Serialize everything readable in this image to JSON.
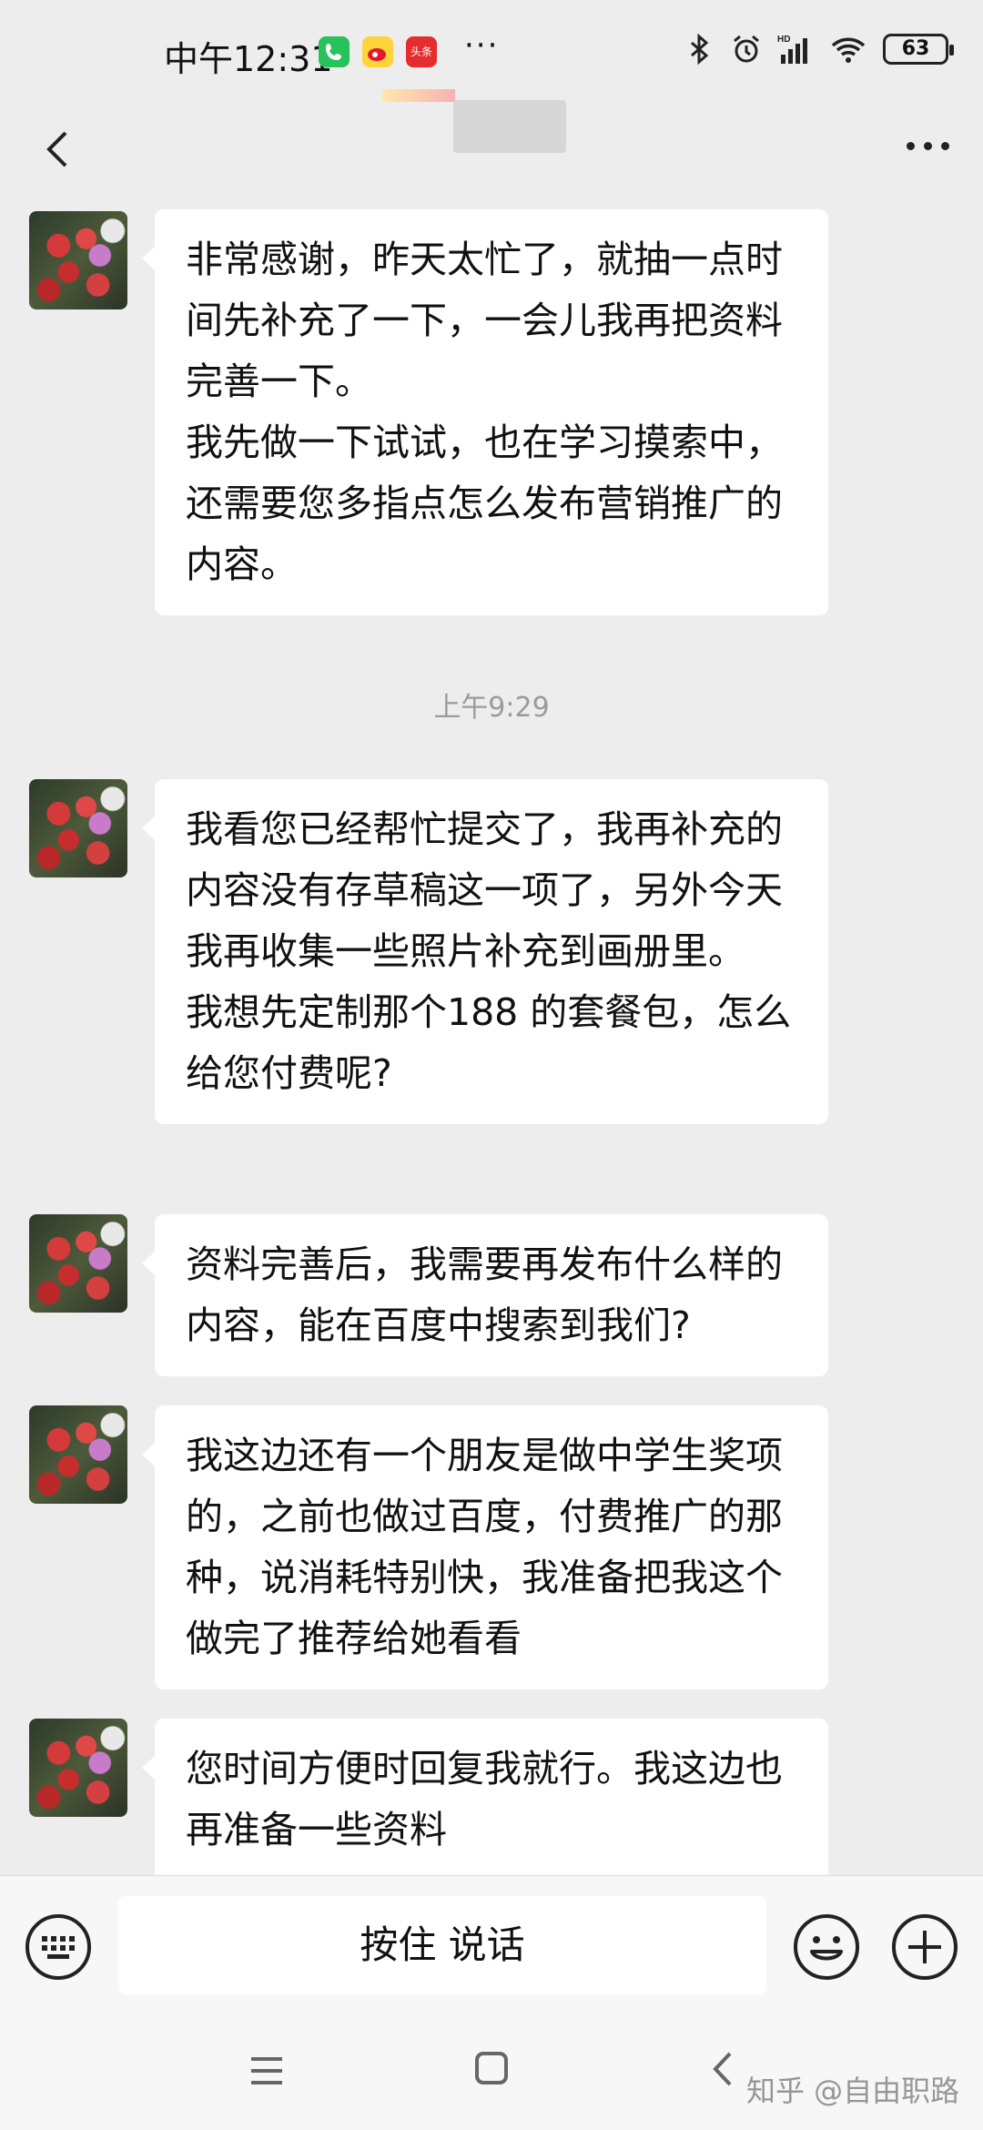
{
  "status_bar": {
    "time": "中午12:31",
    "app_icons": [
      "phone-app-icon",
      "weibo-app-icon",
      "toutiao-app-icon"
    ],
    "toutiao_label": "头条",
    "more": "···",
    "battery": "63",
    "status_icons": [
      "bluetooth-icon",
      "alarm-icon",
      "signal-hd-icon",
      "wifi-icon",
      "battery-icon"
    ]
  },
  "header": {
    "back_icon": "chevron-left-icon",
    "more_icon": "more-dots-icon"
  },
  "messages": [
    {
      "lines": [
        "非常感谢，昨天太忙了，就抽一点时间先补充了一下，一会儿我再把资料完善一下。",
        "我先做一下试试，也在学习摸索中，还需要您多指点怎么发布营销推广的内容。"
      ]
    },
    {
      "lines": [
        "我看您已经帮忙提交了，我再补充的内容没有存草稿这一项了，另外今天我再收集一些照片补充到画册里。",
        "我想先定制那个188 的套餐包，怎么给您付费呢?"
      ]
    },
    {
      "lines": [
        "资料完善后，我需要再发布什么样的内容，能在百度中搜索到我们?"
      ]
    },
    {
      "lines": [
        "我这边还有一个朋友是做中学生奖项的，之前也做过百度，付费推广的那种，说消耗特别快，我准备把我这个做完了推荐给她看看"
      ]
    },
    {
      "lines": [
        "您时间方便时回复我就行。我这边也再准备一些资料"
      ]
    }
  ],
  "time_divider": "上午9:29",
  "input_bar": {
    "voice_label": "按住 说话",
    "keyboard_icon": "keyboard-icon",
    "emoji_icon": "emoji-icon",
    "plus_icon": "plus-icon"
  },
  "nav_bar": {
    "watermark": "知乎 @自由职路",
    "icons": [
      "menu-icon",
      "home-icon",
      "back-icon"
    ]
  },
  "colors": {
    "background": "#ededed",
    "bubble": "#ffffff",
    "phone_chip": "#27c25b",
    "toutiao_chip": "#e52d2d"
  }
}
